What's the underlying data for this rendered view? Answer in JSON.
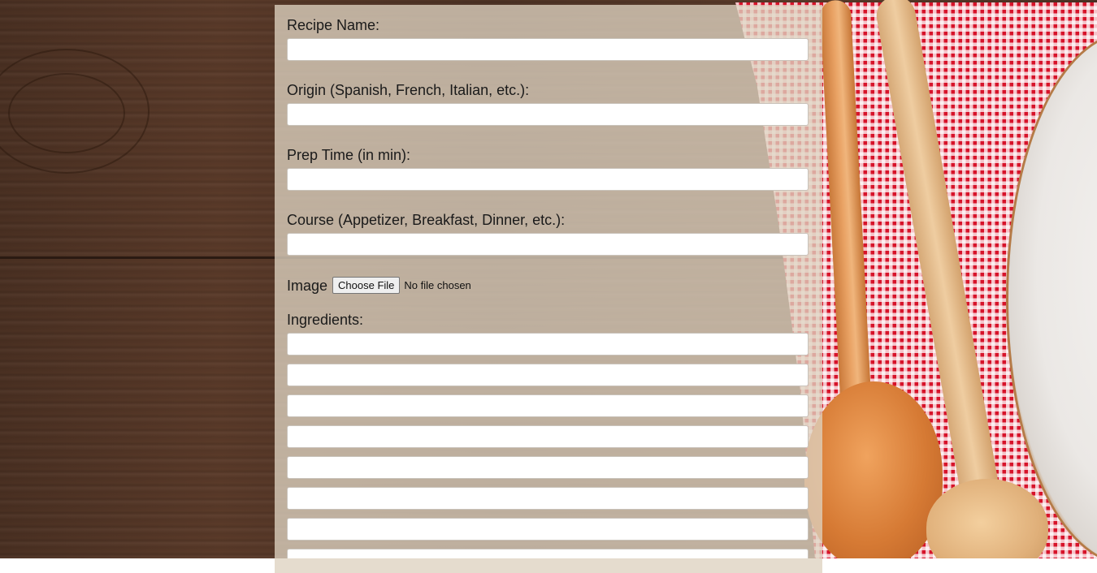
{
  "form": {
    "recipe_name_label": "Recipe Name:",
    "recipe_name_value": "",
    "origin_label": "Origin (Spanish, French, Italian, etc.):",
    "origin_value": "",
    "prep_time_label": "Prep Time (in min):",
    "prep_time_value": "",
    "course_label": "Course (Appetizer, Breakfast, Dinner, etc.):",
    "course_value": "",
    "image_label": "Image",
    "choose_file_label": "Choose File",
    "file_status": "No file chosen",
    "ingredients_label": "Ingredients:",
    "ingredients": [
      "",
      "",
      "",
      "",
      "",
      "",
      "",
      ""
    ]
  }
}
